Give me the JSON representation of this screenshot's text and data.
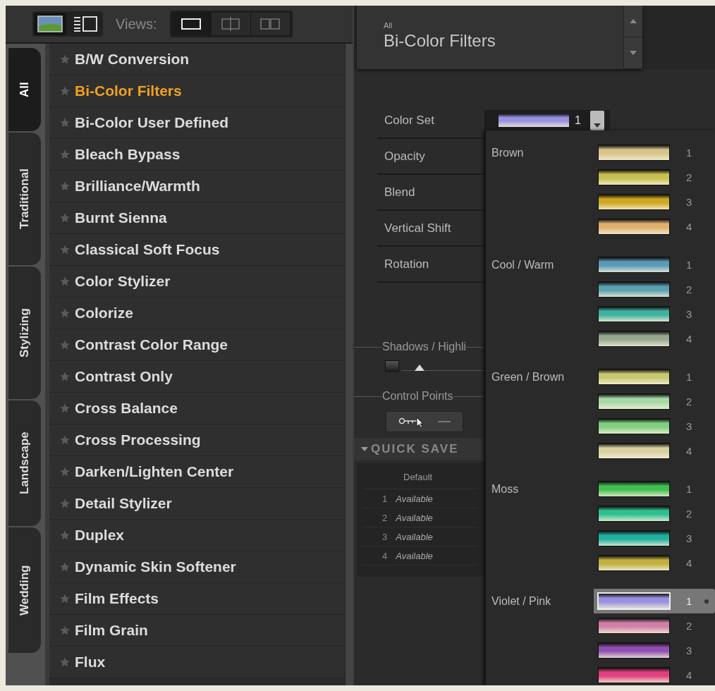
{
  "toolbar": {
    "mode_buttons": [
      {
        "kind": "image",
        "selected": true
      },
      {
        "kind": "list",
        "selected": false
      }
    ],
    "views_label": "Views:",
    "views": [
      {
        "kind": "single",
        "selected": true
      },
      {
        "kind": "split",
        "selected": false
      },
      {
        "kind": "side",
        "selected": false
      }
    ]
  },
  "tabs": [
    {
      "label": "All",
      "selected": true
    },
    {
      "label": "Traditional",
      "selected": false
    },
    {
      "label": "Stylizing",
      "selected": false
    },
    {
      "label": "Landscape",
      "selected": false
    },
    {
      "label": "Wedding",
      "selected": false
    }
  ],
  "filters": [
    {
      "label": "B/W Conversion",
      "selected": false
    },
    {
      "label": "Bi-Color Filters",
      "selected": true
    },
    {
      "label": "Bi-Color User Defined",
      "selected": false
    },
    {
      "label": "Bleach Bypass",
      "selected": false
    },
    {
      "label": "Brilliance/Warmth",
      "selected": false
    },
    {
      "label": "Burnt Sienna",
      "selected": false
    },
    {
      "label": "Classical Soft Focus",
      "selected": false
    },
    {
      "label": "Color Stylizer",
      "selected": false
    },
    {
      "label": "Colorize",
      "selected": false
    },
    {
      "label": "Contrast Color Range",
      "selected": false
    },
    {
      "label": "Contrast Only",
      "selected": false
    },
    {
      "label": "Cross Balance",
      "selected": false
    },
    {
      "label": "Cross Processing",
      "selected": false
    },
    {
      "label": "Darken/Lighten Center",
      "selected": false
    },
    {
      "label": "Detail Stylizer",
      "selected": false
    },
    {
      "label": "Duplex",
      "selected": false
    },
    {
      "label": "Dynamic Skin Softener",
      "selected": false
    },
    {
      "label": "Film Effects",
      "selected": false
    },
    {
      "label": "Film Grain",
      "selected": false
    },
    {
      "label": "Flux",
      "selected": false
    }
  ],
  "header": {
    "category": "All",
    "title": "Bi-Color Filters"
  },
  "params": [
    "Color Set",
    "Opacity",
    "Blend",
    "Vertical Shift",
    "Rotation"
  ],
  "color_set": {
    "value": "1"
  },
  "shadows": {
    "label": "Shadows / Highli",
    "level": 0.06
  },
  "control_points": {
    "label": "Control Points"
  },
  "quick_save": {
    "title": "QUICK SAVE",
    "heading": "Default",
    "slots": [
      {
        "number": "1",
        "label": "Available"
      },
      {
        "number": "2",
        "label": "Available"
      },
      {
        "number": "3",
        "label": "Available"
      },
      {
        "number": "4",
        "label": "Available"
      }
    ]
  },
  "color_sets": [
    {
      "name": "Brown",
      "swatches": [
        {
          "label": "1",
          "color": "#d8c48a",
          "selected": false
        },
        {
          "label": "2",
          "color": "#c8c050",
          "selected": false
        },
        {
          "label": "3",
          "color": "#d0a820",
          "selected": false
        },
        {
          "label": "4",
          "color": "#e0b070",
          "selected": false
        }
      ]
    },
    {
      "name": "Cool / Warm",
      "swatches": [
        {
          "label": "1",
          "color": "#5a9ab8",
          "selected": false
        },
        {
          "label": "2",
          "color": "#5aa0b0",
          "selected": false
        },
        {
          "label": "3",
          "color": "#40b0a0",
          "selected": false
        },
        {
          "label": "4",
          "color": "#98a890",
          "selected": false
        }
      ]
    },
    {
      "name": "Green / Brown",
      "swatches": [
        {
          "label": "1",
          "color": "#c8c870",
          "selected": false
        },
        {
          "label": "2",
          "color": "#a8d8a8",
          "selected": false
        },
        {
          "label": "3",
          "color": "#80d080",
          "selected": false
        },
        {
          "label": "4",
          "color": "#d8d0a0",
          "selected": false
        }
      ]
    },
    {
      "name": "Moss",
      "swatches": [
        {
          "label": "1",
          "color": "#40c050",
          "selected": false
        },
        {
          "label": "2",
          "color": "#30c090",
          "selected": false
        },
        {
          "label": "3",
          "color": "#20b0a0",
          "selected": false
        },
        {
          "label": "4",
          "color": "#c0b040",
          "selected": false
        }
      ]
    },
    {
      "name": "Violet / Pink",
      "swatches": [
        {
          "label": "1",
          "color": "#9890e0",
          "selected": true
        },
        {
          "label": "2",
          "color": "#d080a8",
          "selected": false
        },
        {
          "label": "3",
          "color": "#9050b0",
          "selected": false
        },
        {
          "label": "4",
          "color": "#e04080",
          "selected": false
        }
      ]
    }
  ]
}
